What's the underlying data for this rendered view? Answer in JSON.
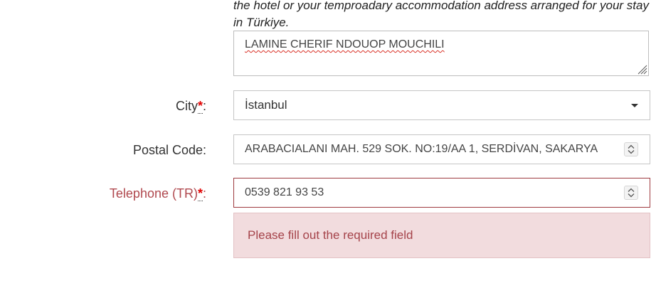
{
  "address": {
    "hint": "the hotel or your temproadary accommodation address arranged for your stay in Türkiye.",
    "value": "LAMINE CHERIF NDOUOP MOUCHILI"
  },
  "city": {
    "label": "City",
    "required_mark": "*",
    "suffix": ":",
    "value": "İstanbul"
  },
  "postal_code": {
    "label": "Postal Code:",
    "value": "ARABACIALANI MAH. 529 SOK. NO:19/AA 1, SERDİVAN, SAKARYA"
  },
  "telephone": {
    "label": "Telephone (TR)",
    "required_mark": "*",
    "suffix": ":",
    "value": "0539 821 93 53",
    "error_message": "Please fill out the required field"
  },
  "colors": {
    "error_text": "#b0484e",
    "required_mark": "#e00000",
    "alert_background": "#f2dcde"
  }
}
